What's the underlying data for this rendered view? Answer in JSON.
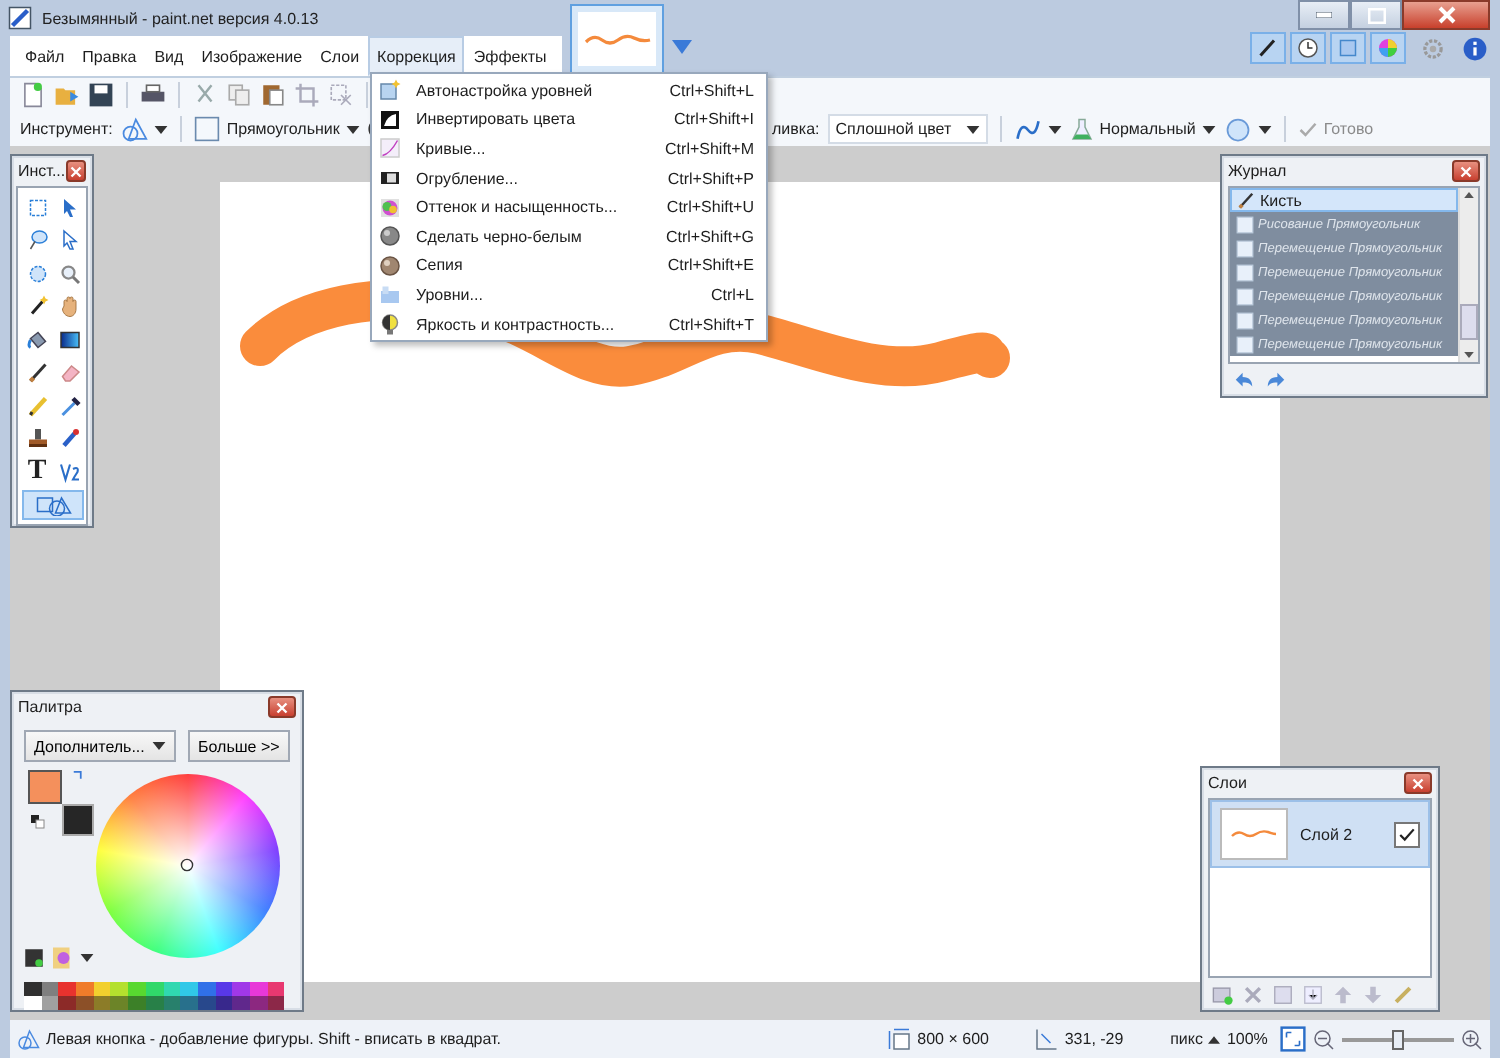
{
  "window": {
    "title": "Безымянный - paint.net версия 4.0.13"
  },
  "menu": [
    {
      "label": "Файл",
      "selected": false
    },
    {
      "label": "Правка",
      "selected": false
    },
    {
      "label": "Вид",
      "selected": false
    },
    {
      "label": "Изображение",
      "selected": false
    },
    {
      "label": "Слои",
      "selected": false
    },
    {
      "label": "Коррекция",
      "selected": true
    },
    {
      "label": "Эффекты",
      "selected": false
    }
  ],
  "toolbar": {
    "tool_label": "Инструмент:",
    "shape": "Прямоугольник",
    "fill_label": "ливка:",
    "fill_value": "Сплошной цвет",
    "blend_mode": "Нормальный",
    "done": {
      "label": "Готово",
      "disabled": true
    }
  },
  "dropdown": [
    {
      "label": "Автонастройка уровней",
      "shortcut": "Ctrl+Shift+L"
    },
    {
      "label": "Инвертировать цвета",
      "shortcut": "Ctrl+Shift+I"
    },
    {
      "label": "Кривые...",
      "shortcut": "Ctrl+Shift+M"
    },
    {
      "label": "Огрубление...",
      "shortcut": "Ctrl+Shift+P"
    },
    {
      "label": "Оттенок и насыщенность...",
      "shortcut": "Ctrl+Shift+U"
    },
    {
      "label": "Сделать черно-белым",
      "shortcut": "Ctrl+Shift+G"
    },
    {
      "label": "Сепия",
      "shortcut": "Ctrl+Shift+E"
    },
    {
      "label": "Уровни...",
      "shortcut": "Ctrl+L"
    },
    {
      "label": "Яркость и контрастность...",
      "shortcut": "Ctrl+Shift+T"
    }
  ],
  "tools_panel": {
    "title": "Инст...",
    "tools": [
      {
        "kind": "rectangle-select",
        "selected": false
      },
      {
        "kind": "move-selection",
        "selected": false
      },
      {
        "kind": "lasso",
        "selected": false
      },
      {
        "kind": "move",
        "selected": false
      },
      {
        "kind": "ellipse-select",
        "selected": false
      },
      {
        "kind": "zoom",
        "selected": false
      },
      {
        "kind": "magic-wand",
        "selected": false
      },
      {
        "kind": "hand",
        "selected": false
      },
      {
        "kind": "paint-bucket",
        "selected": false
      },
      {
        "kind": "gradient",
        "selected": false
      },
      {
        "kind": "brush",
        "selected": false
      },
      {
        "kind": "eraser",
        "selected": false
      },
      {
        "kind": "pencil",
        "selected": false
      },
      {
        "kind": "color-picker",
        "selected": false
      },
      {
        "kind": "clone-stamp",
        "selected": false
      },
      {
        "kind": "recolor",
        "selected": false
      },
      {
        "kind": "text",
        "glyph": "T",
        "selected": false
      },
      {
        "kind": "line",
        "selected": false
      },
      {
        "kind": "shapes",
        "selected": true
      }
    ]
  },
  "history": {
    "title": "Журнал",
    "items": [
      {
        "kind": "brush",
        "label": "Кисть",
        "selected": true,
        "disabled": false
      },
      {
        "kind": "rectangle",
        "label": "Рисование Прямоугольник",
        "selected": false,
        "disabled": true
      },
      {
        "kind": "rectangle",
        "label": "Перемещение Прямоугольник",
        "selected": false,
        "disabled": true
      },
      {
        "kind": "rectangle",
        "label": "Перемещение Прямоугольник",
        "selected": false,
        "disabled": true
      },
      {
        "kind": "rectangle",
        "label": "Перемещение Прямоугольник",
        "selected": false,
        "disabled": true
      },
      {
        "kind": "rectangle",
        "label": "Перемещение Прямоугольник",
        "selected": false,
        "disabled": true
      },
      {
        "kind": "rectangle",
        "label": "Перемещение Прямоугольник",
        "selected": false,
        "disabled": true
      }
    ]
  },
  "palette": {
    "title": "Палитра",
    "mode": "Дополнитель...",
    "more_button": "Больше >>",
    "colors": [
      {
        "kind": "primary",
        "color": "#f4905c"
      },
      {
        "kind": "secondary",
        "color": "#262626"
      }
    ],
    "swatches": [
      {
        "color": "#303030"
      },
      {
        "color": "#7f7f7f"
      },
      {
        "color": "#e8322e"
      },
      {
        "color": "#f07c2a"
      },
      {
        "color": "#f2d02e"
      },
      {
        "color": "#b4e02e"
      },
      {
        "color": "#58d830"
      },
      {
        "color": "#30d86a"
      },
      {
        "color": "#30d8b0"
      },
      {
        "color": "#30c8e8"
      },
      {
        "color": "#3070e8"
      },
      {
        "color": "#5838e8"
      },
      {
        "color": "#a038e8"
      },
      {
        "color": "#e838d8"
      },
      {
        "color": "#e83870"
      },
      {
        "color": "#ffffff"
      },
      {
        "color": "#a0a0a0"
      },
      {
        "color": "#8c2a28"
      },
      {
        "color": "#8c5028"
      },
      {
        "color": "#8c7c28"
      },
      {
        "color": "#6c8428"
      },
      {
        "color": "#3c8028"
      },
      {
        "color": "#288048"
      },
      {
        "color": "#28806c"
      },
      {
        "color": "#28708c"
      },
      {
        "color": "#28488c"
      },
      {
        "color": "#38288c"
      },
      {
        "color": "#60288c"
      },
      {
        "color": "#8c2880"
      },
      {
        "color": "#8c2848"
      }
    ]
  },
  "layers": {
    "title": "Слои",
    "items": [
      {
        "name": "Слой 2",
        "selected": true,
        "visible": true
      }
    ]
  },
  "status_bar": {
    "hint": "Левая кнопка - добавление фигуры. Shift - вписать в квадрат.",
    "image_size": "800 × 600",
    "cursor": "331, -29",
    "unit": "пикс",
    "zoom": "100%",
    "zoom_slider": {
      "level": 0.5
    }
  }
}
